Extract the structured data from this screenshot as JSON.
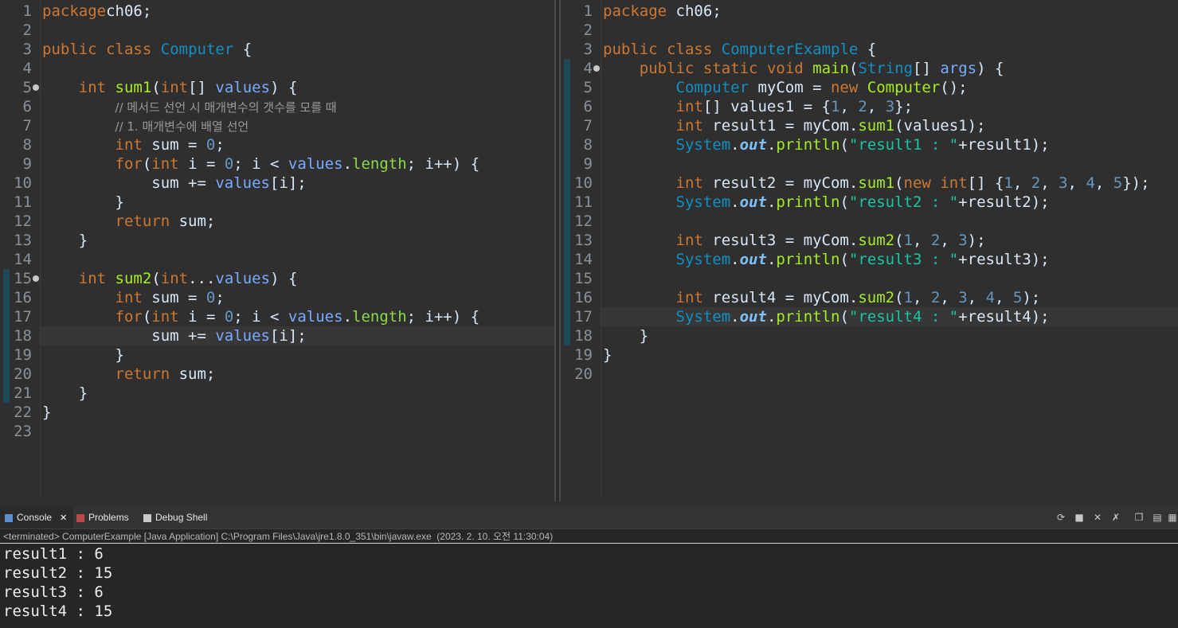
{
  "editors": [
    {
      "file": "Computer",
      "highlight_line": 18,
      "fold_lines": [
        5,
        15
      ],
      "change_lines": [
        15,
        16,
        17,
        18,
        19,
        20,
        21
      ],
      "lines": [
        [
          [
            "kw",
            "package"
          ],
          [
            "",
            "ch06;"
          ]
        ],
        [],
        [
          [
            "kw",
            "public"
          ],
          [
            "",
            " "
          ],
          [
            "kw",
            "class"
          ],
          [
            "",
            " "
          ],
          [
            "typ",
            "Computer"
          ],
          [
            "",
            " {"
          ]
        ],
        [],
        [
          [
            "",
            "    "
          ],
          [
            "kw",
            "int"
          ],
          [
            "",
            " "
          ],
          [
            "fn",
            "sum1"
          ],
          [
            "",
            "("
          ],
          [
            "kw",
            "int"
          ],
          [
            "",
            "[] "
          ],
          [
            "var",
            "values"
          ],
          [
            "",
            ") {"
          ]
        ],
        [
          [
            "",
            "        "
          ],
          [
            "cm",
            "// 메서드 선언 시 매개변수의 갯수를 모를 때"
          ]
        ],
        [
          [
            "",
            "        "
          ],
          [
            "cm",
            "// 1. 매개변수에 배열 선언"
          ]
        ],
        [
          [
            "",
            "        "
          ],
          [
            "kw",
            "int"
          ],
          [
            "",
            " sum = "
          ],
          [
            "num",
            "0"
          ],
          [
            "",
            ";"
          ]
        ],
        [
          [
            "",
            "        "
          ],
          [
            "kw",
            "for"
          ],
          [
            "",
            "("
          ],
          [
            "kw",
            "int"
          ],
          [
            "",
            " i = "
          ],
          [
            "num",
            "0"
          ],
          [
            "",
            "; i < "
          ],
          [
            "var",
            "values"
          ],
          [
            "",
            "."
          ],
          [
            "fld",
            "length"
          ],
          [
            "",
            "; i++) {"
          ]
        ],
        [
          [
            "",
            "            sum += "
          ],
          [
            "var",
            "values"
          ],
          [
            "",
            "[i];"
          ]
        ],
        [
          [
            "",
            "        }"
          ]
        ],
        [
          [
            "",
            "        "
          ],
          [
            "kw",
            "return"
          ],
          [
            "",
            " sum;"
          ]
        ],
        [
          [
            "",
            "    }"
          ]
        ],
        [],
        [
          [
            "",
            "    "
          ],
          [
            "kw",
            "int"
          ],
          [
            "",
            " "
          ],
          [
            "fn",
            "sum2"
          ],
          [
            "",
            "("
          ],
          [
            "kw",
            "int"
          ],
          [
            "",
            "..."
          ],
          [
            "var",
            "values"
          ],
          [
            "",
            ") {"
          ]
        ],
        [
          [
            "",
            "        "
          ],
          [
            "kw",
            "int"
          ],
          [
            "",
            " sum = "
          ],
          [
            "num",
            "0"
          ],
          [
            "",
            ";"
          ]
        ],
        [
          [
            "",
            "        "
          ],
          [
            "kw",
            "for"
          ],
          [
            "",
            "("
          ],
          [
            "kw",
            "int"
          ],
          [
            "",
            " i = "
          ],
          [
            "num",
            "0"
          ],
          [
            "",
            "; i < "
          ],
          [
            "var",
            "values"
          ],
          [
            "",
            "."
          ],
          [
            "fld",
            "length"
          ],
          [
            "",
            "; i++) {"
          ]
        ],
        [
          [
            "",
            "            sum += "
          ],
          [
            "var",
            "values"
          ],
          [
            "",
            "[i];"
          ]
        ],
        [
          [
            "",
            "        }"
          ]
        ],
        [
          [
            "",
            "        "
          ],
          [
            "kw",
            "return"
          ],
          [
            "",
            " sum;"
          ]
        ],
        [
          [
            "",
            "    }"
          ]
        ],
        [
          [
            "",
            "}"
          ]
        ],
        []
      ]
    },
    {
      "file": "ComputerExample",
      "highlight_line": 17,
      "fold_lines": [
        4
      ],
      "change_lines": [
        4,
        5,
        6,
        7,
        8,
        9,
        10,
        11,
        12,
        13,
        14,
        15,
        16,
        17,
        18
      ],
      "lines": [
        [
          [
            "kw",
            "package"
          ],
          [
            "",
            " ch06;"
          ]
        ],
        [],
        [
          [
            "kw",
            "public"
          ],
          [
            "",
            " "
          ],
          [
            "kw",
            "class"
          ],
          [
            "",
            " "
          ],
          [
            "typ",
            "ComputerExample"
          ],
          [
            "",
            " {"
          ]
        ],
        [
          [
            "",
            "    "
          ],
          [
            "kw",
            "public"
          ],
          [
            "",
            " "
          ],
          [
            "kw",
            "static"
          ],
          [
            "",
            " "
          ],
          [
            "kw",
            "void"
          ],
          [
            "",
            " "
          ],
          [
            "fn",
            "main"
          ],
          [
            "",
            "("
          ],
          [
            "typ",
            "String"
          ],
          [
            "",
            "[] "
          ],
          [
            "var",
            "args"
          ],
          [
            "",
            ") {"
          ]
        ],
        [
          [
            "",
            "        "
          ],
          [
            "typ",
            "Computer"
          ],
          [
            "",
            " myCom = "
          ],
          [
            "kw",
            "new"
          ],
          [
            "",
            " "
          ],
          [
            "fn",
            "Computer"
          ],
          [
            "",
            "();"
          ]
        ],
        [
          [
            "",
            "        "
          ],
          [
            "kw",
            "int"
          ],
          [
            "",
            "[] values1 = {"
          ],
          [
            "num",
            "1"
          ],
          [
            "",
            ", "
          ],
          [
            "num",
            "2"
          ],
          [
            "",
            ", "
          ],
          [
            "num",
            "3"
          ],
          [
            "",
            "};"
          ]
        ],
        [
          [
            "",
            "        "
          ],
          [
            "kw",
            "int"
          ],
          [
            "",
            " result1 = myCom."
          ],
          [
            "fn",
            "sum1"
          ],
          [
            "",
            "(values1);"
          ]
        ],
        [
          [
            "",
            "        "
          ],
          [
            "typ",
            "System"
          ],
          [
            "",
            "."
          ],
          [
            "stat",
            "out"
          ],
          [
            "",
            "."
          ],
          [
            "fn",
            "println"
          ],
          [
            "",
            "("
          ],
          [
            "str",
            "\"result1 : \""
          ],
          [
            "",
            "+result1);"
          ]
        ],
        [],
        [
          [
            "",
            "        "
          ],
          [
            "kw",
            "int"
          ],
          [
            "",
            " result2 = myCom."
          ],
          [
            "fn",
            "sum1"
          ],
          [
            "",
            "("
          ],
          [
            "kw",
            "new"
          ],
          [
            "",
            " "
          ],
          [
            "kw",
            "int"
          ],
          [
            "",
            "[] {"
          ],
          [
            "num",
            "1"
          ],
          [
            "",
            ", "
          ],
          [
            "num",
            "2"
          ],
          [
            "",
            ", "
          ],
          [
            "num",
            "3"
          ],
          [
            "",
            ", "
          ],
          [
            "num",
            "4"
          ],
          [
            "",
            ", "
          ],
          [
            "num",
            "5"
          ],
          [
            "",
            "});"
          ]
        ],
        [
          [
            "",
            "        "
          ],
          [
            "typ",
            "System"
          ],
          [
            "",
            "."
          ],
          [
            "stat",
            "out"
          ],
          [
            "",
            "."
          ],
          [
            "fn",
            "println"
          ],
          [
            "",
            "("
          ],
          [
            "str",
            "\"result2 : \""
          ],
          [
            "",
            "+result2);"
          ]
        ],
        [],
        [
          [
            "",
            "        "
          ],
          [
            "kw",
            "int"
          ],
          [
            "",
            " result3 = myCom."
          ],
          [
            "fn",
            "sum2"
          ],
          [
            "",
            "("
          ],
          [
            "num",
            "1"
          ],
          [
            "",
            ", "
          ],
          [
            "num",
            "2"
          ],
          [
            "",
            ", "
          ],
          [
            "num",
            "3"
          ],
          [
            "",
            ");"
          ]
        ],
        [
          [
            "",
            "        "
          ],
          [
            "typ",
            "System"
          ],
          [
            "",
            "."
          ],
          [
            "stat",
            "out"
          ],
          [
            "",
            "."
          ],
          [
            "fn",
            "println"
          ],
          [
            "",
            "("
          ],
          [
            "str",
            "\"result3 : \""
          ],
          [
            "",
            "+result3);"
          ]
        ],
        [],
        [
          [
            "",
            "        "
          ],
          [
            "kw",
            "int"
          ],
          [
            "",
            " result4 = myCom."
          ],
          [
            "fn",
            "sum2"
          ],
          [
            "",
            "("
          ],
          [
            "num",
            "1"
          ],
          [
            "",
            ", "
          ],
          [
            "num",
            "2"
          ],
          [
            "",
            ", "
          ],
          [
            "num",
            "3"
          ],
          [
            "",
            ", "
          ],
          [
            "num",
            "4"
          ],
          [
            "",
            ", "
          ],
          [
            "num",
            "5"
          ],
          [
            "",
            ");"
          ]
        ],
        [
          [
            "",
            "        "
          ],
          [
            "typ",
            "System"
          ],
          [
            "",
            "."
          ],
          [
            "stat",
            "out"
          ],
          [
            "",
            "."
          ],
          [
            "fn",
            "println"
          ],
          [
            "",
            "("
          ],
          [
            "str",
            "\"result4 : \""
          ],
          [
            "",
            "+result4);"
          ]
        ],
        [
          [
            "",
            "    }"
          ]
        ],
        [
          [
            "",
            "}"
          ]
        ],
        []
      ]
    }
  ],
  "console": {
    "tabs": [
      {
        "label": "Console",
        "active": true,
        "icon": "console-icon"
      },
      {
        "label": "Problems",
        "active": false,
        "icon": "problems-icon"
      },
      {
        "label": "Debug Shell",
        "active": false,
        "icon": "debug-shell-icon"
      }
    ],
    "close_glyph": "✕",
    "status": "<terminated> ComputerExample [Java Application] C:\\Program Files\\Java\\jre1.8.0_351\\bin\\javaw.exe  (2023. 2. 10. 오전 11:30:04)",
    "output": [
      "result1 : 6",
      "result2 : 15",
      "result3 : 6",
      "result4 : 15"
    ],
    "toolbar_icons": [
      "sync-icon",
      "stop-icon",
      "remove-icon",
      "remove-all-icon",
      "copy-icon",
      "new-console-icon",
      "display-icon"
    ]
  }
}
